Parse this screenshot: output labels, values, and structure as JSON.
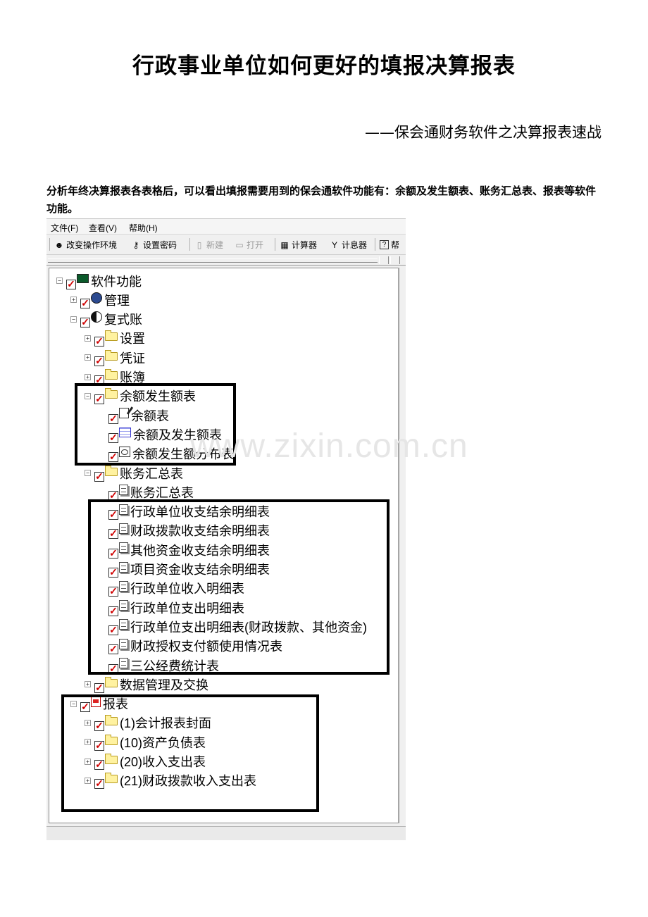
{
  "document": {
    "title": "行政事业单位如何更好的填报决算报表",
    "subtitle": "——保会通财务软件之决算报表速战",
    "intro": "分析年终决算报表各表格后，可以看出填报需要用到的保会通软件功能有：余额及发生额表、账务汇总表、报表等软件功能。",
    "watermark": "www.zixin.com.cn"
  },
  "screenshot": {
    "menu": [
      "文件(F)",
      "查看(V)",
      "帮助(H)"
    ],
    "toolbar": {
      "change_env": "改变操作环境",
      "set_password": "设置密码",
      "new": "新建",
      "open": "打开",
      "calculator": "计算器",
      "counter": "计息器",
      "help": "帮"
    },
    "tree": [
      {
        "label": "软件功能",
        "icon": "monitor-icon",
        "exp": "-"
      },
      {
        "label": "管理",
        "icon": "gear-icon",
        "exp": "+"
      },
      {
        "label": "复式账",
        "icon": "yinyang-icon",
        "exp": "-"
      },
      {
        "label": "设置",
        "icon": "folder-icon",
        "exp": "+"
      },
      {
        "label": "凭证",
        "icon": "folder-icon",
        "exp": "+"
      },
      {
        "label": "账簿",
        "icon": "folder-icon",
        "exp": "+"
      },
      {
        "label": "余额发生额表",
        "icon": "folder-open-icon",
        "exp": "-"
      },
      {
        "label": "余额表",
        "icon": "edit-icon",
        "exp": ""
      },
      {
        "label": "余额及发生额表",
        "icon": "table-icon",
        "exp": ""
      },
      {
        "label": "余额发生额分布表",
        "icon": "distribution-icon",
        "exp": ""
      },
      {
        "label": "账务汇总表",
        "icon": "folder-open-icon",
        "exp": "-"
      },
      {
        "label": "账务汇总表",
        "icon": "document-icon",
        "exp": ""
      },
      {
        "label": "行政单位收支结余明细表",
        "icon": "document-icon",
        "exp": ""
      },
      {
        "label": "财政拨款收支结余明细表",
        "icon": "document-icon",
        "exp": ""
      },
      {
        "label": "其他资金收支结余明细表",
        "icon": "document-icon",
        "exp": ""
      },
      {
        "label": "项目资金收支结余明细表",
        "icon": "document-icon",
        "exp": ""
      },
      {
        "label": "行政单位收入明细表",
        "icon": "document-icon",
        "exp": ""
      },
      {
        "label": "行政单位支出明细表",
        "icon": "document-icon",
        "exp": ""
      },
      {
        "label": "行政单位支出明细表(财政拨款、其他资金)",
        "icon": "document-icon",
        "exp": ""
      },
      {
        "label": "财政授权支付额使用情况表",
        "icon": "document-icon",
        "exp": ""
      },
      {
        "label": "三公经费统计表",
        "icon": "document-icon",
        "exp": ""
      },
      {
        "label": "数据管理及交换",
        "icon": "folder-icon",
        "exp": "+"
      },
      {
        "label": "报表",
        "icon": "report-icon",
        "exp": "-"
      },
      {
        "label": "(1)会计报表封面",
        "icon": "folder-icon",
        "exp": "+"
      },
      {
        "label": "(10)资产负债表",
        "icon": "folder-icon",
        "exp": "+"
      },
      {
        "label": "(20)收入支出表",
        "icon": "folder-icon",
        "exp": "+"
      },
      {
        "label": "(21)财政拨款收入支出表",
        "icon": "folder-icon",
        "exp": "+"
      }
    ]
  }
}
